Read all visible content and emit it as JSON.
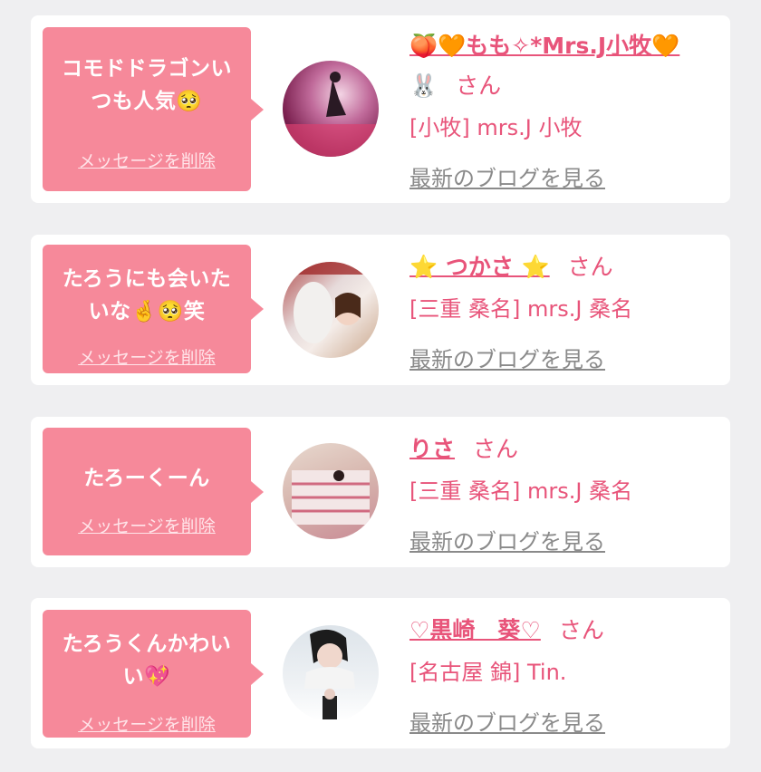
{
  "messages": [
    {
      "bubble_line1": "コモドドラゴンい",
      "bubble_line2": "つも人気🥺",
      "delete_label": "メッセージを削除",
      "name_line1": "🍑🧡もも✧*Mrs.J小牧🧡",
      "name_line2": "🐰",
      "san": "さん",
      "shop": "[小牧] mrs.J 小牧",
      "blog_link": "最新のブログを見る"
    },
    {
      "bubble_line1": "たろうにも会いた",
      "bubble_line2": "いな🤞🥺笑",
      "delete_label": "メッセージを削除",
      "name_line1": "⭐ つかさ ⭐",
      "san": "さん",
      "shop": "[三重 桑名] mrs.J 桑名",
      "blog_link": "最新のブログを見る"
    },
    {
      "bubble_line1": "たろーくーん",
      "delete_label": "メッセージを削除",
      "name_line1": "りさ",
      "san": "さん",
      "shop": "[三重 桑名] mrs.J 桑名",
      "blog_link": "最新のブログを見る"
    },
    {
      "bubble_line1": "たろうくんかわい",
      "bubble_line2": "い💖",
      "delete_label": "メッセージを削除",
      "name_line1": "♡黒崎　葵♡",
      "san": "さん",
      "shop": "[名古屋 錦] Tin.",
      "blog_link": "最新のブログを見る"
    }
  ]
}
